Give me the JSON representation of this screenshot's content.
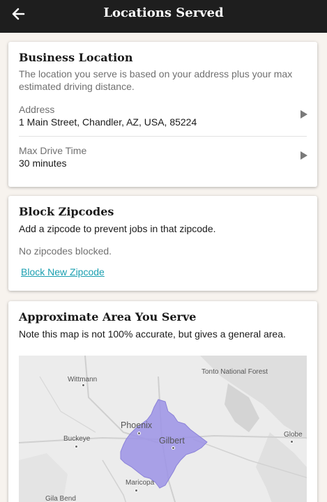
{
  "header": {
    "title": "Locations Served",
    "back_icon": "arrow-left-icon"
  },
  "business_location": {
    "title": "Business Location",
    "description": "The location you serve is based on your address plus your max estimated driving distance.",
    "address_label": "Address",
    "address_value": "1 Main Street, Chandler, AZ, USA, 85224",
    "drive_label": "Max Drive Time",
    "drive_value": "30 minutes"
  },
  "block_zipcodes": {
    "title": "Block Zipcodes",
    "description": "Add a zipcode to prevent jobs in that zipcode.",
    "empty_text": "No zipcodes blocked.",
    "link_label": "Block New Zipcode"
  },
  "area": {
    "title": "Approximate Area You Serve",
    "description": "Note this map is not 100% accurate, but gives a general area.",
    "map": {
      "labels": {
        "wittmann": "Wittmann",
        "tonto": "Tonto National Forest",
        "phoenix": "Phoenix",
        "gilbert": "Gilbert",
        "buckeye": "Buckeye",
        "globe": "Globe",
        "maricopa": "Maricopa",
        "gila_bend": "Gila Bend"
      },
      "service_area_color": "#9c93e6"
    }
  },
  "colors": {
    "topbar": "#1e1e1e",
    "background": "#f7f3ee",
    "link": "#1a9fb0"
  }
}
